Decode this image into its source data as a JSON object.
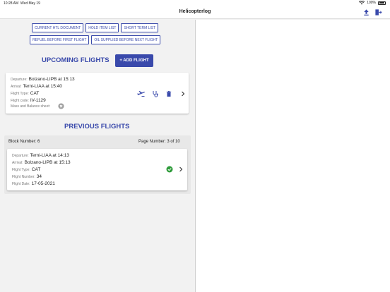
{
  "status": {
    "time": "10:28 AM",
    "date": "Wed May 19",
    "battery": "100%"
  },
  "app": {
    "title": "Helicopterlog"
  },
  "toolbar": {
    "row1": [
      "CURRENT HTL DOCUMENT",
      "HOLD ITEM LIST",
      "SHORT TERM LIST"
    ],
    "row2": [
      "REFUEL BEFORE FIRST FLIGHT",
      "OIL SUPPLIED BEFORE NEXT FLIGHT"
    ]
  },
  "upcoming": {
    "title": "UPCOMING FLIGHTS",
    "add_label": "+ ADD FLIGHT",
    "flight": {
      "departure_label": "Departure:",
      "departure": "Bolzano-LIPB at 15:13",
      "arrival_label": "Arrival:",
      "arrival": "Terni-LIAA at 15:40",
      "type_label": "Flight Type:",
      "type": "CAT",
      "code_label": "Flight code:",
      "code": "IV-1129",
      "mb_label": "Mass and Balance sheet:"
    }
  },
  "previous": {
    "title": "PREVIOUS FLIGHTS",
    "block_number": "Block Number: 6",
    "page_number": "Page Number: 3 of 10",
    "flight": {
      "departure_label": "Departure:",
      "departure": "Terni-LIAA at 14:13",
      "arrival_label": "Arrival:",
      "arrival": "Bolzano-LIPB at 15:13",
      "type_label": "Flight Type:",
      "type": "CAT",
      "number_label": "Flight Number:",
      "number": "34",
      "date_label": "Flight Date:",
      "date": "17-05-2021"
    }
  },
  "colors": {
    "accent": "#3949ab",
    "success": "#2e9b3a"
  }
}
